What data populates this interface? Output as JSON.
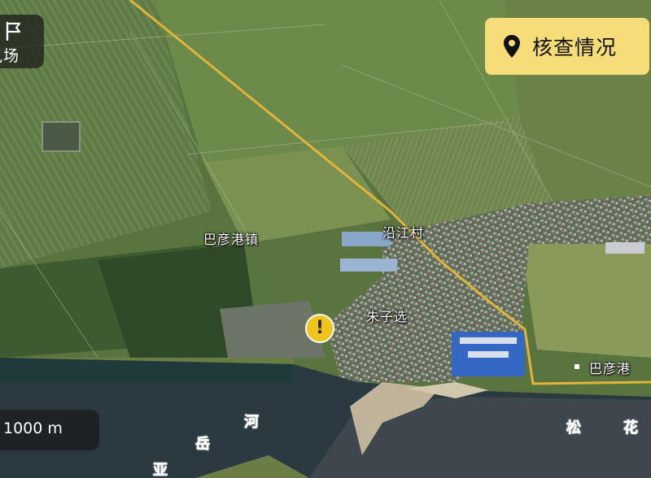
{
  "map": {
    "top_left_badge": {
      "icon": "flag-icon",
      "label": "风场"
    },
    "check_button": {
      "icon": "location-pin-icon",
      "label": "核查情况"
    },
    "scale": {
      "label": "1000 m"
    },
    "places": [
      {
        "key": "town",
        "label": "巴彦港镇"
      },
      {
        "key": "village1",
        "label": "沿江村"
      },
      {
        "key": "village2",
        "label": "朱子选"
      },
      {
        "key": "poi",
        "label": "巴彦港"
      }
    ],
    "river_chars": [
      "河",
      "岳",
      "亚",
      "松",
      "花"
    ],
    "alert_marker": {
      "icon": "exclamation-icon",
      "symbol": "!"
    },
    "colors": {
      "check_button_bg": "#f7dc7a",
      "alert_marker": "#f0c41b",
      "route_line": "#e2b43a",
      "river_label": "#3a7bd5"
    }
  }
}
